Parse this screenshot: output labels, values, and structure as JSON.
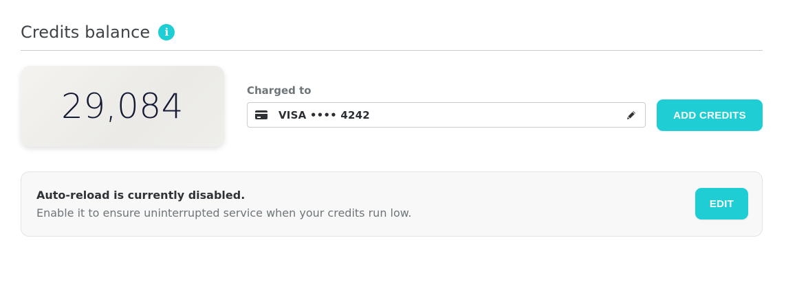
{
  "header": {
    "title": "Credits balance",
    "info_icon": "info-icon",
    "info_glyph": "i"
  },
  "balance": {
    "value": "29,084"
  },
  "payment": {
    "label": "Charged to",
    "card_icon": "credit-card-icon",
    "card_text": "VISA •••• 4242",
    "edit_icon": "pencil-icon"
  },
  "actions": {
    "add_credits_label": "ADD CREDITS"
  },
  "auto_reload": {
    "title": "Auto-reload is currently disabled.",
    "description": "Enable it to ensure uninterrupted service when your credits run low.",
    "edit_label": "EDIT"
  },
  "colors": {
    "accent": "#1fcdd4",
    "balance_text": "#141a33",
    "muted_text": "#6e7579"
  }
}
